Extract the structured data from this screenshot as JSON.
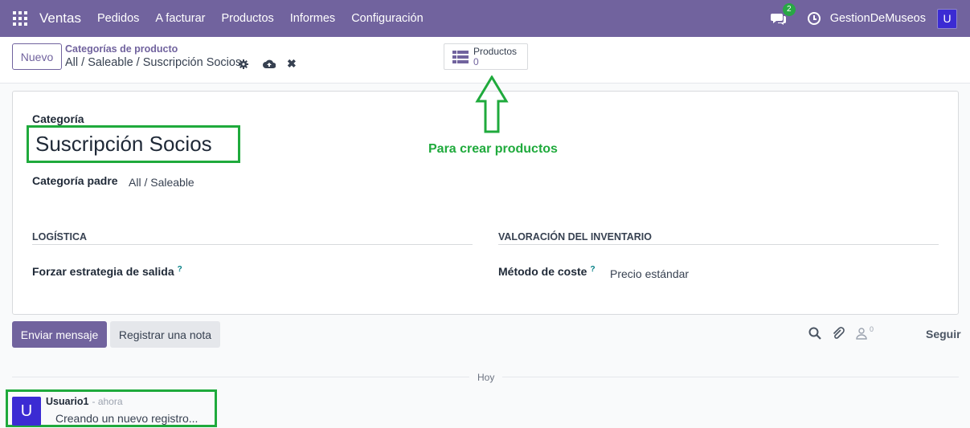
{
  "navbar": {
    "brand": "Ventas",
    "menu": [
      "Pedidos",
      "A facturar",
      "Productos",
      "Informes",
      "Configuración"
    ],
    "messages_badge": "2",
    "company": "GestionDeMuseos",
    "user_initial": "U",
    "icons": [
      "apps-grid-icon",
      "chat-icon",
      "clock-icon"
    ]
  },
  "control_panel": {
    "new_label": "Nuevo",
    "breadcrumb_parent": "Categorías de producto",
    "breadcrumb_current": "All / Saleable / Suscripción Socios",
    "smart_button": {
      "label": "Productos",
      "value": "0"
    }
  },
  "annotation": {
    "text": "Para crear productos",
    "color": "#1faa3c"
  },
  "form": {
    "category_label": "Categoría",
    "category_name": "Suscripción Socios",
    "parent_label": "Categoría padre",
    "parent_value": "All / Saleable",
    "sections": {
      "logistics": {
        "title": "LOGÍSTICA",
        "field_label": "Forzar estrategia de salida",
        "help": "?"
      },
      "valuation": {
        "title": "VALORACIÓN DEL INVENTARIO",
        "field_label": "Método de coste",
        "help": "?",
        "field_value": "Precio estándar"
      }
    }
  },
  "chatter": {
    "send_label": "Enviar mensaje",
    "note_label": "Registrar una nota",
    "followers_count": "0",
    "follow_label": "Seguir",
    "date_separator": "Hoy",
    "message": {
      "avatar_initial": "U",
      "author": "Usuario1",
      "time": "- ahora",
      "body": "Creando un nuevo registro..."
    }
  },
  "colors": {
    "primary": "#71639e",
    "highlight": "#1faa3c",
    "avatar": "#3b2bd3"
  }
}
